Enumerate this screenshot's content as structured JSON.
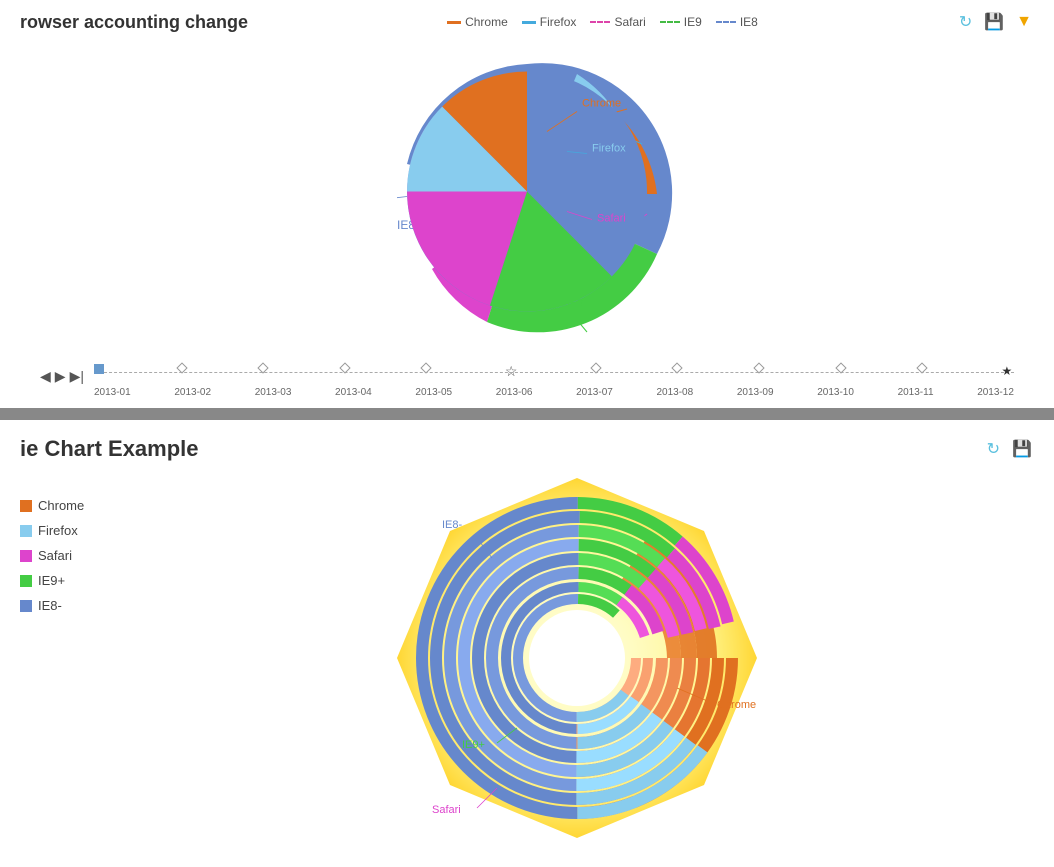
{
  "top": {
    "title": "rowser accounting change",
    "legend": [
      {
        "label": "Chrome",
        "color": "#e07020",
        "lineStyle": "solid"
      },
      {
        "label": "Firefox",
        "color": "#44aadd",
        "lineStyle": "solid"
      },
      {
        "label": "Safari",
        "color": "#dd44aa",
        "lineStyle": "dashed"
      },
      {
        "label": "IE9",
        "color": "#44bb44",
        "lineStyle": "dashed"
      },
      {
        "label": "IE8",
        "color": "#6688cc",
        "lineStyle": "dashed"
      }
    ],
    "timeline": {
      "months": [
        "2013-01",
        "2013-02",
        "2013-03",
        "2013-04",
        "2013-05",
        "2013-06",
        "2013-07",
        "2013-08",
        "2013-09",
        "2013-10",
        "2013-11",
        "2013-12"
      ]
    }
  },
  "pie": {
    "labels": {
      "chrome": "Chrome",
      "firefox": "Firefox",
      "safari": "Safari",
      "ie9": "IE9+",
      "ie8": "IE8-"
    },
    "colors": {
      "chrome": "#e07020",
      "firefox": "#88ccee",
      "safari": "#dd44cc",
      "ie9": "#44cc44",
      "ie8": "#6688cc"
    }
  },
  "bottom": {
    "title": "ie Chart Example",
    "legend": [
      {
        "label": "Chrome",
        "color": "#e07020"
      },
      {
        "label": "Firefox",
        "color": "#88ccee"
      },
      {
        "label": "Safari",
        "color": "#dd44cc"
      },
      {
        "label": "IE9+",
        "color": "#44cc44"
      },
      {
        "label": "IE8-",
        "color": "#6688cc"
      }
    ],
    "donut": {
      "labels": {
        "ie8": "IE8-",
        "ie9": "IE9+",
        "safari": "Safari",
        "chrome": "Chrome"
      }
    }
  },
  "actions": {
    "refresh": "↻",
    "download": "⬇",
    "filter": "▼"
  }
}
